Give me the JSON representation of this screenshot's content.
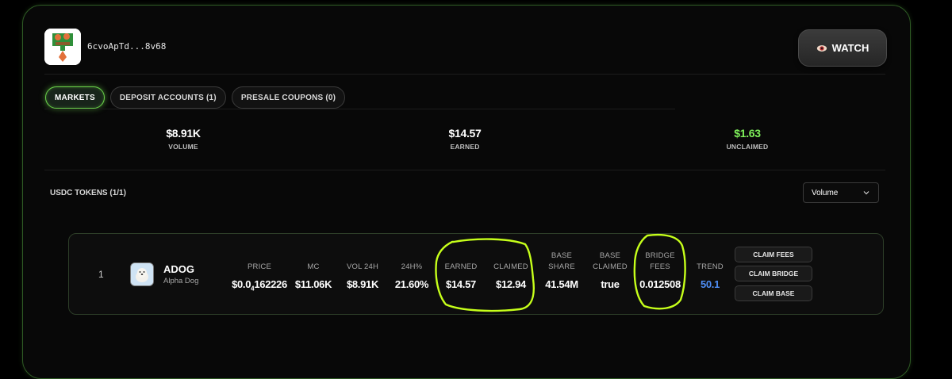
{
  "profile": {
    "wallet": "6cvoApTd...8v68"
  },
  "watch_button": {
    "label": "WATCH"
  },
  "tabs": [
    {
      "label": "MARKETS",
      "active": true
    },
    {
      "label": "DEPOSIT ACCOUNTS (1)",
      "active": false
    },
    {
      "label": "PRESALE COUPONS (0)",
      "active": false
    }
  ],
  "stats": [
    {
      "value": "$8.91K",
      "label": "VOLUME"
    },
    {
      "value": "$14.57",
      "label": "EARNED"
    },
    {
      "value": "$1.63",
      "label": "UNCLAIMED"
    }
  ],
  "section": {
    "title": "USDC TOKENS (1/1)"
  },
  "sort_select": {
    "value": "Volume"
  },
  "token_row": {
    "rank": "1",
    "ticker": "ADOG",
    "name": "Alpha Dog",
    "columns": {
      "price": {
        "header": "PRICE",
        "value_a": "$0.0",
        "value_sub": "4",
        "value_b": "162226"
      },
      "mc": {
        "header": "MC",
        "value": "$11.06K"
      },
      "vol24h": {
        "header": "VOL 24H",
        "value": "$8.91K"
      },
      "change24h": {
        "header": "24H%",
        "value": "21.60%"
      },
      "earned": {
        "header": "EARNED",
        "value": "$14.57"
      },
      "claimed": {
        "header": "CLAIMED",
        "value": "$12.94"
      },
      "base_share": {
        "header_1": "BASE",
        "header_2": "SHARE",
        "value": "41.54M"
      },
      "base_claimed": {
        "header_1": "BASE",
        "header_2": "CLAIMED",
        "value": "true"
      },
      "bridge_fees": {
        "header_1": "BRIDGE",
        "header_2": "FEES",
        "value": "0.012508"
      },
      "trend": {
        "header": "TREND",
        "value": "50.1"
      }
    },
    "actions": [
      "CLAIM FEES",
      "CLAIM BRIDGE",
      "CLAIM BASE"
    ]
  },
  "colors": {
    "accent_green": "#7ef05a",
    "trend_blue": "#4f8ff7",
    "highlight_annotation": "#c6ff1a",
    "panel_border": "#2e5a24"
  }
}
